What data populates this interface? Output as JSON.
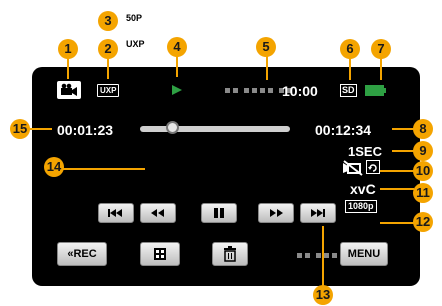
{
  "top_tags": {
    "frame_rate": "50P",
    "quality": "UXP"
  },
  "screen": {
    "clock": "10:00",
    "media_badge": "SD",
    "elapsed_time": "00:01:23",
    "total_time": "00:12:34",
    "playback_progress": 0.12,
    "interval": "1SEC",
    "format": "xvC",
    "resolution_badge": "1080p",
    "rec_button": "REC",
    "menu_button": "MENU"
  },
  "icons": [
    "video-mode-icon",
    "play-indicator-icon",
    "battery-icon",
    "rewind-skip-icon",
    "rewind-icon",
    "pause-icon",
    "fast-forward-icon",
    "forward-skip-icon",
    "index-icon",
    "trash-icon",
    "stabilizer-off-icon",
    "rotate-icon"
  ],
  "callouts": [
    "1",
    "2",
    "3",
    "4",
    "5",
    "6",
    "7",
    "8",
    "9",
    "10",
    "11",
    "12",
    "13",
    "14",
    "15"
  ],
  "colors": {
    "callout": "#f4a400",
    "play": "#2ea043",
    "battery": "#2ea043",
    "screen": "#000000"
  }
}
